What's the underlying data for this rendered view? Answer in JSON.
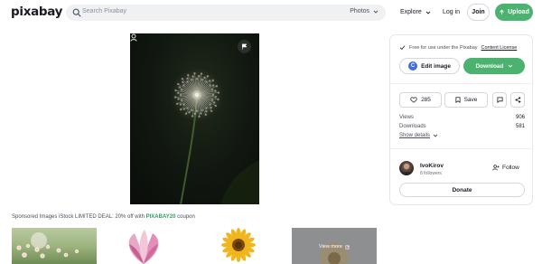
{
  "header": {
    "logo": "pixabay",
    "search_placeholder": "Search Pixabay",
    "search_type": "Photos",
    "explore_label": "Explore",
    "login_label": "Log in",
    "join_label": "Join",
    "upload_label": "Upload"
  },
  "panel": {
    "license_text": "Free for use under the Pixabay",
    "license_link": "Content License",
    "edit_label": "Edit image",
    "download_label": "Download",
    "likes": "285",
    "save_label": "Save",
    "stats": [
      {
        "label": "Views",
        "value": "906"
      },
      {
        "label": "Downloads",
        "value": "581"
      }
    ],
    "show_details": "Show details",
    "user": {
      "name": "IvoKirov",
      "followers": "8 followers",
      "follow_label": "Follow"
    },
    "donate_label": "Donate"
  },
  "sponsored": {
    "text": "Sponsored Images iStock LIMITED DEAL: 20% off with",
    "code": "PIXABAY20",
    "suffix": "coupon",
    "view_more": "View more"
  },
  "colors": {
    "accent": "#4bb36f",
    "coupon": "#2f9e5d",
    "edit_icon": "#3f6fd8"
  }
}
